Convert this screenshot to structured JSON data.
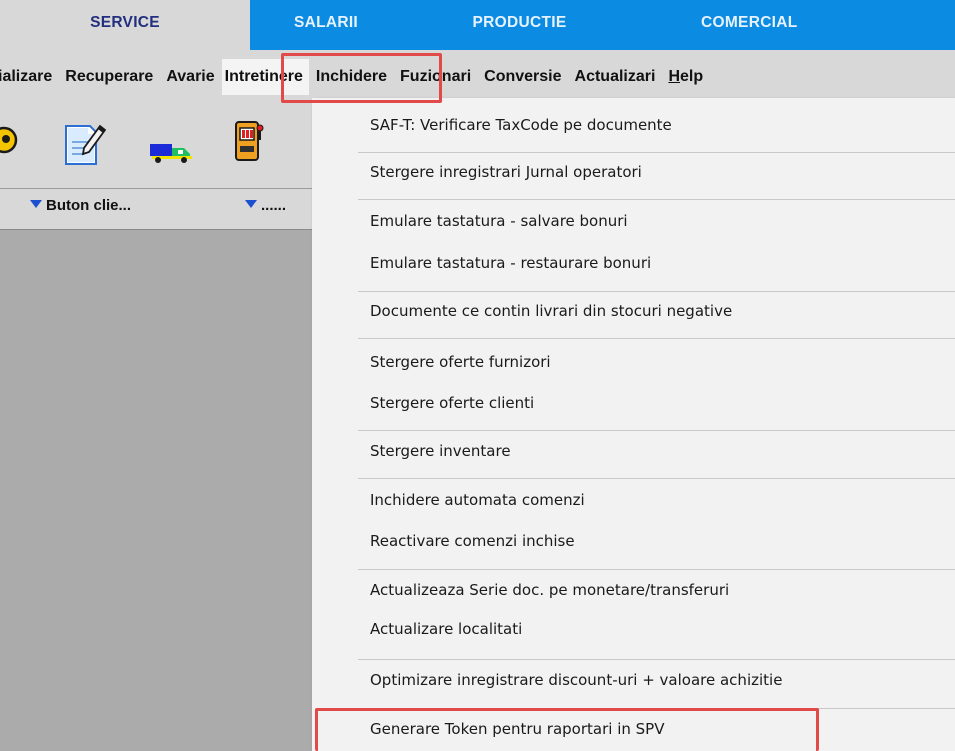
{
  "tabs": [
    {
      "label": "SERVICE",
      "active": true
    },
    {
      "label": "SALARII"
    },
    {
      "label": "PRODUCTIE"
    },
    {
      "label": "COMERCIAL"
    }
  ],
  "menubar": {
    "items": [
      "ializare",
      "Recuperare",
      "Avarie",
      "Intretinere",
      "Inchidere",
      "Fuzionari",
      "Conversie",
      "Actualizari"
    ],
    "help_first": "H",
    "help_rest": "elp",
    "open_item": "Intretinere"
  },
  "toolbar": {
    "icons": [
      "coin-icon",
      "edit-document-icon",
      "delivery-truck-icon",
      "slot-machine-icon"
    ]
  },
  "subbar": {
    "button1_label": "Buton clie...",
    "button2_label": "......"
  },
  "dropdown": {
    "items": [
      "SAF-T: Verificare TaxCode pe documente",
      "Stergere inregistrari Jurnal operatori",
      "Emulare tastatura - salvare bonuri",
      "Emulare tastatura - restaurare bonuri",
      "Documente ce contin livrari din stocuri negative",
      "Stergere oferte furnizori",
      "Stergere oferte clienti",
      "Stergere inventare",
      "Inchidere automata comenzi",
      "Reactivare comenzi inchise",
      "Actualizeaza Serie doc. pe monetare/transferuri",
      "Actualizare localitati",
      "Optimizare inregistrare discount-uri + valoare achizitie",
      "Generare Token pentru raportari in SPV"
    ]
  },
  "colors": {
    "tab_active_bg": "#d8d8d8",
    "tab_active_text": "#222f7e",
    "tab_inactive_bg": "#0c8be3",
    "highlight_red": "#e24a4a",
    "dropdown_bg": "#f2f2f2"
  }
}
